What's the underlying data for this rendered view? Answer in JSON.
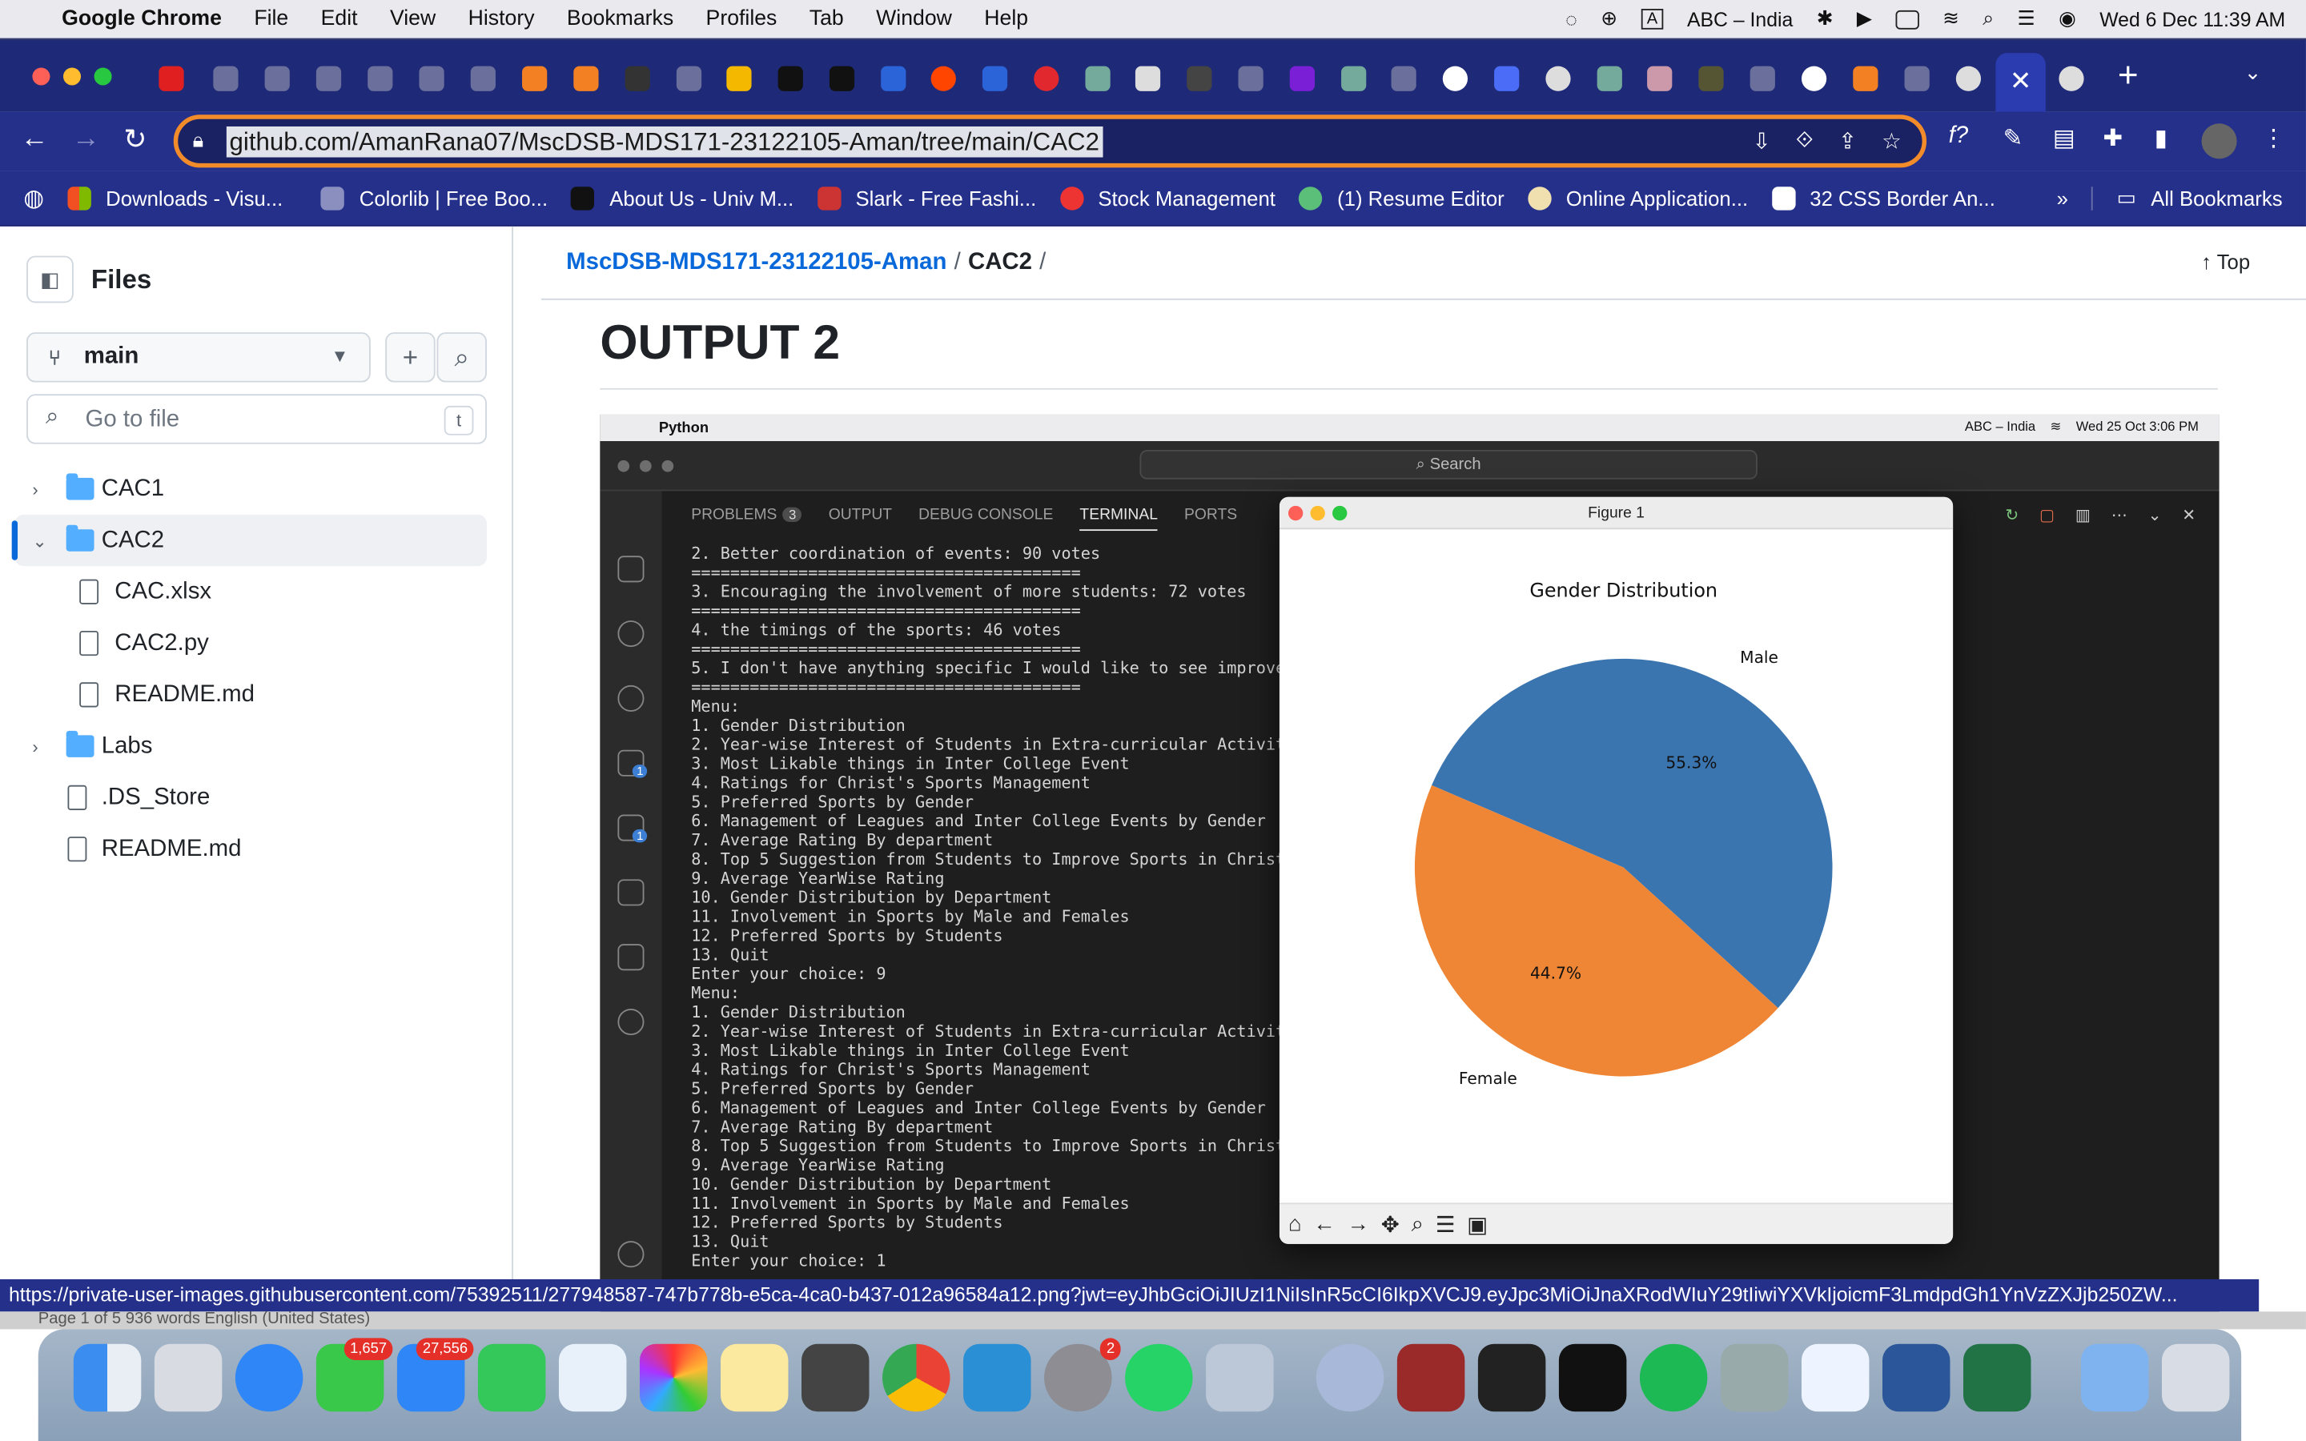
{
  "menubar": {
    "app": "Google Chrome",
    "items": [
      "File",
      "Edit",
      "View",
      "History",
      "Bookmarks",
      "Profiles",
      "Tab",
      "Window",
      "Help"
    ],
    "input_source": "ABC – India",
    "datetime": "Wed 6 Dec  11:39 AM"
  },
  "toolbar": {
    "url": "github.com/AmanRana07/MscDSB-MDS171-23122105-Aman/tree/main/CAC2"
  },
  "bookmarks": {
    "items": [
      "Downloads - Visu...",
      "Colorlib | Free Boo...",
      "About Us - Univ M...",
      "Slark - Free Fashi...",
      "Stock Management",
      "(1) Resume Editor",
      "Online Application...",
      "32 CSS Border An..."
    ],
    "overflow": "»",
    "all": "All Bookmarks"
  },
  "sidebar": {
    "title": "Files",
    "branch": "main",
    "goto_placeholder": "Go to file",
    "goto_key": "t",
    "tree": {
      "cac1": "CAC1",
      "cac2": "CAC2",
      "cac_xlsx": "CAC.xlsx",
      "cac2_py": "CAC2.py",
      "cac2_readme": "README.md",
      "labs": "Labs",
      "ds_store": ".DS_Store",
      "readme": "README.md"
    }
  },
  "main": {
    "breadcrumb_repo": "MscDSB-MDS171-23122105-Aman",
    "breadcrumb_folder": "CAC2",
    "top": "Top",
    "heading": "OUTPUT 2"
  },
  "screenshot": {
    "app": "Python",
    "input_source": "ABC – India",
    "datetime": "Wed 25 Oct  3:06 PM",
    "search": "Search",
    "tabs": {
      "problems": "PROBLEMS",
      "problems_count": "3",
      "output": "OUTPUT",
      "debug": "DEBUG CONSOLE",
      "terminal": "TERMINAL",
      "ports": "PORTS"
    },
    "badge_run": "1",
    "badge_ext": "1",
    "terminal": "2. Better coordination of events: 90 votes\n========================================\n3. Encouraging the involvement of more students: 72 votes\n========================================\n4. the timings of the sports: 46 votes\n========================================\n5. I don't have anything specific I would like to see improved\n========================================\nMenu:\n1. Gender Distribution\n2. Year-wise Interest of Students in Extra-curricular Activities\n3. Most Likable things in Inter College Event\n4. Ratings for Christ's Sports Management\n5. Preferred Sports by Gender\n6. Management of Leagues and Inter College Events by Gender\n7. Average Rating By department\n8. Top 5 Suggestion from Students to Improve Sports in Christ\n9. Average YearWise Rating\n10. Gender Distribution by Department\n11. Involvement in Sports by Male and Females\n12. Preferred Sports by Students\n13. Quit\nEnter your choice: 9\nMenu:\n1. Gender Distribution\n2. Year-wise Interest of Students in Extra-curricular Activities\n3. Most Likable things in Inter College Event\n4. Ratings for Christ's Sports Management\n5. Preferred Sports by Gender\n6. Management of Leagues and Inter College Events by Gender\n7. Average Rating By department\n8. Top 5 Suggestion from Students to Improve Sports in Christ\n9. Average YearWise Rating\n10. Gender Distribution by Department\n11. Involvement in Sports by Male and Females\n12. Preferred Sports by Students\n13. Quit\nEnter your choice: 1",
    "figure_title": "Figure 1"
  },
  "chart_data": {
    "type": "pie",
    "title": "Gender Distribution",
    "categories": [
      "Male",
      "Female"
    ],
    "values": [
      55.3,
      44.7
    ],
    "labels": [
      "55.3%",
      "44.7%"
    ],
    "colors": [
      "#3b75af",
      "#ef8636"
    ]
  },
  "status_url": "https://private-user-images.githubusercontent.com/75392511/277948587-747b778b-e5ca-4ca0-b437-012a96584a12.png?jwt=eyJhbGciOiJIUzI1NiIsInR5cCI6IkpXVCJ9.eyJpc3MiOiJnaXRodWIuY29tIiwiYXVkIjoicmF3LmdpdGh1YnVzZXJjb250ZW...",
  "behind_window": "Page 1 of 5    936 words    English (United States)",
  "dock": {
    "messages_badge": "1,657",
    "mail_badge": "27,556",
    "settings_badge": "2"
  }
}
